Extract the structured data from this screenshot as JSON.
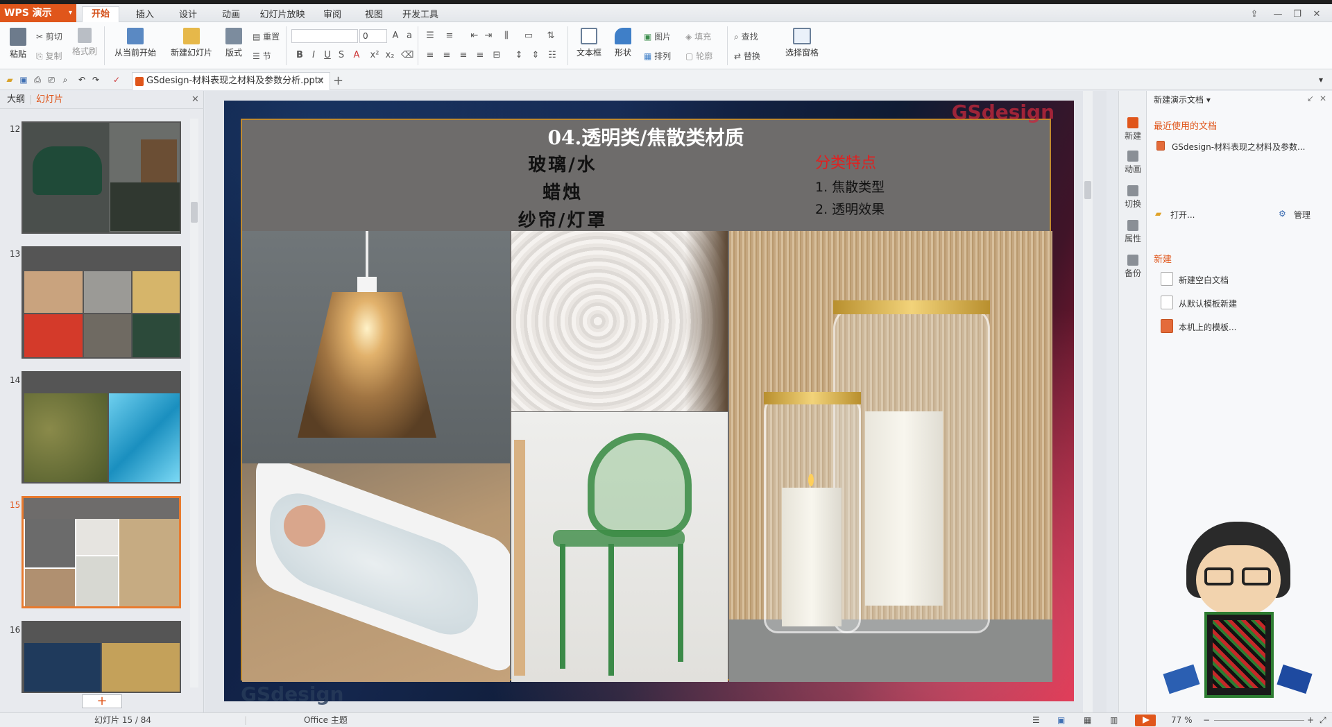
{
  "app": {
    "logo": "WPS 演示",
    "accent": "#e0561b"
  },
  "menu": [
    "开始",
    "插入",
    "设计",
    "动画",
    "幻灯片放映",
    "审阅",
    "视图",
    "开发工具"
  ],
  "ribbon": {
    "paste": "粘贴",
    "cut": "剪切",
    "copy": "复制",
    "format_painter": "格式刷",
    "from_current": "从当前开始",
    "new_slide": "新建幻灯片",
    "layout": "版式",
    "reset": "重置",
    "section": "节",
    "font_size": "0",
    "textbox": "文本框",
    "shape": "形状",
    "picture": "图片",
    "fill": "填充",
    "arrange": "排列",
    "outline": "轮廓",
    "find": "查找",
    "replace": "替换",
    "selection_pane": "选择窗格"
  },
  "doc_tab": {
    "name": "GSdesign-材料表现之材料及参数分析.pptx"
  },
  "left_panel": {
    "tabs": [
      "大纲",
      "幻灯片"
    ],
    "slides": [
      {
        "num": "12"
      },
      {
        "num": "13"
      },
      {
        "num": "14"
      },
      {
        "num": "15"
      },
      {
        "num": "16"
      }
    ],
    "add": "+"
  },
  "slide": {
    "title": "04.透明类/焦散类材质",
    "lines": [
      "玻璃/水",
      "蜡烛",
      "纱帘/灯罩"
    ],
    "features_title": "分类特点",
    "features": [
      "1. 焦散类型",
      "2. 透明效果"
    ],
    "watermark": "GSdesign"
  },
  "rail": [
    "新建",
    "动画",
    "切换",
    "属性",
    "备份"
  ],
  "task_pane": {
    "header": "新建演示文档",
    "recent_title": "最近使用的文档",
    "recent_file": "GSdesign-材料表现之材料及参数...",
    "open": "打开...",
    "manage": "管理",
    "new_title": "新建",
    "new_items": [
      "新建空白文档",
      "从默认模板新建",
      "本机上的模板..."
    ]
  },
  "status": {
    "slide": "幻灯片 15 / 84",
    "theme": "Office 主题",
    "zoom": "77 %"
  }
}
